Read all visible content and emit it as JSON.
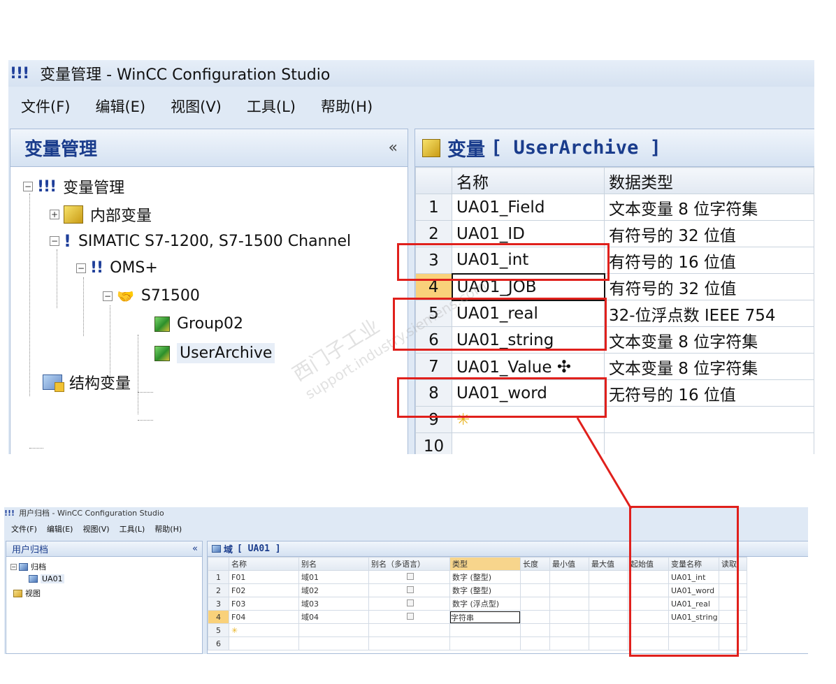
{
  "top": {
    "app_icon": "!!!",
    "title": "变量管理 - WinCC Configuration Studio",
    "menu": [
      "文件(F)",
      "编辑(E)",
      "视图(V)",
      "工具(L)",
      "帮助(H)"
    ],
    "left_panel": {
      "title": "变量管理",
      "collapse": "«",
      "tree": {
        "root": "变量管理",
        "internal": "内部变量",
        "channel": "SIMATIC S7-1200, S7-1500 Channel",
        "oms": "OMS+",
        "s71500": "S71500",
        "group02": "Group02",
        "userarchive": "UserArchive",
        "struct": "结构变量"
      },
      "scroll_left": "<"
    },
    "right_panel": {
      "label": "变量",
      "tag": "[ UserArchive ]",
      "columns": [
        "名称",
        "数据类型"
      ],
      "rows": [
        {
          "n": "1",
          "name": "UA01_Field",
          "type": "文本变量 8 位字符集"
        },
        {
          "n": "2",
          "name": "UA01_ID",
          "type": "有符号的 32 位值"
        },
        {
          "n": "3",
          "name": "UA01_int",
          "type": "有符号的 16 位值"
        },
        {
          "n": "4",
          "name": "UA01_JOB",
          "type": "有符号的 32 位值"
        },
        {
          "n": "5",
          "name": "UA01_real",
          "type": "32-位浮点数 IEEE 754"
        },
        {
          "n": "6",
          "name": "UA01_string",
          "type": "文本变量 8 位字符集"
        },
        {
          "n": "7",
          "name": "UA01_Value",
          "type": "文本变量 8 位字符集"
        },
        {
          "n": "8",
          "name": "UA01_word",
          "type": "无符号的 16 位值"
        },
        {
          "n": "9",
          "name": "",
          "type": ""
        },
        {
          "n": "10",
          "name": "",
          "type": ""
        }
      ],
      "new_row_marker": "✳"
    }
  },
  "watermark": {
    "line1": "西门子工业",
    "line2": "support.industry.siemens.com"
  },
  "bottom": {
    "title": "用户归档 - WinCC Configuration Studio",
    "menu": [
      "文件(F)",
      "编辑(E)",
      "视图(V)",
      "工具(L)",
      "帮助(H)"
    ],
    "left_panel": {
      "title": "用户归档",
      "collapse": "«",
      "tree": [
        "归档",
        "UA01",
        "视图"
      ]
    },
    "right_panel": {
      "label": "域",
      "tag": "[ UA01 ]",
      "columns": [
        "名称",
        "别名",
        "别名（多语言）",
        "类型",
        "长度",
        "最小值",
        "最大值",
        "起始值",
        "变量名称",
        "读取"
      ],
      "rows": [
        {
          "n": "1",
          "name": "F01",
          "alias": "域01",
          "type": "数字 (整型)",
          "var": "UA01_int"
        },
        {
          "n": "2",
          "name": "F02",
          "alias": "域02",
          "type": "数字 (整型)",
          "var": "UA01_word"
        },
        {
          "n": "3",
          "name": "F03",
          "alias": "域03",
          "type": "数字 (浮点型)",
          "var": "UA01_real"
        },
        {
          "n": "4",
          "name": "F04",
          "alias": "域04",
          "type": "字符串",
          "var": "UA01_string"
        },
        {
          "n": "5",
          "name": "",
          "alias": "",
          "type": "",
          "var": ""
        },
        {
          "n": "6",
          "name": "",
          "alias": "",
          "type": "",
          "var": ""
        }
      ],
      "new_row_marker": "✳",
      "dropdown_arrow": "▾"
    }
  },
  "colors": {
    "annotation": "#e0201c",
    "accent": "#1a3c8c",
    "active_row": "#f9d17a"
  }
}
